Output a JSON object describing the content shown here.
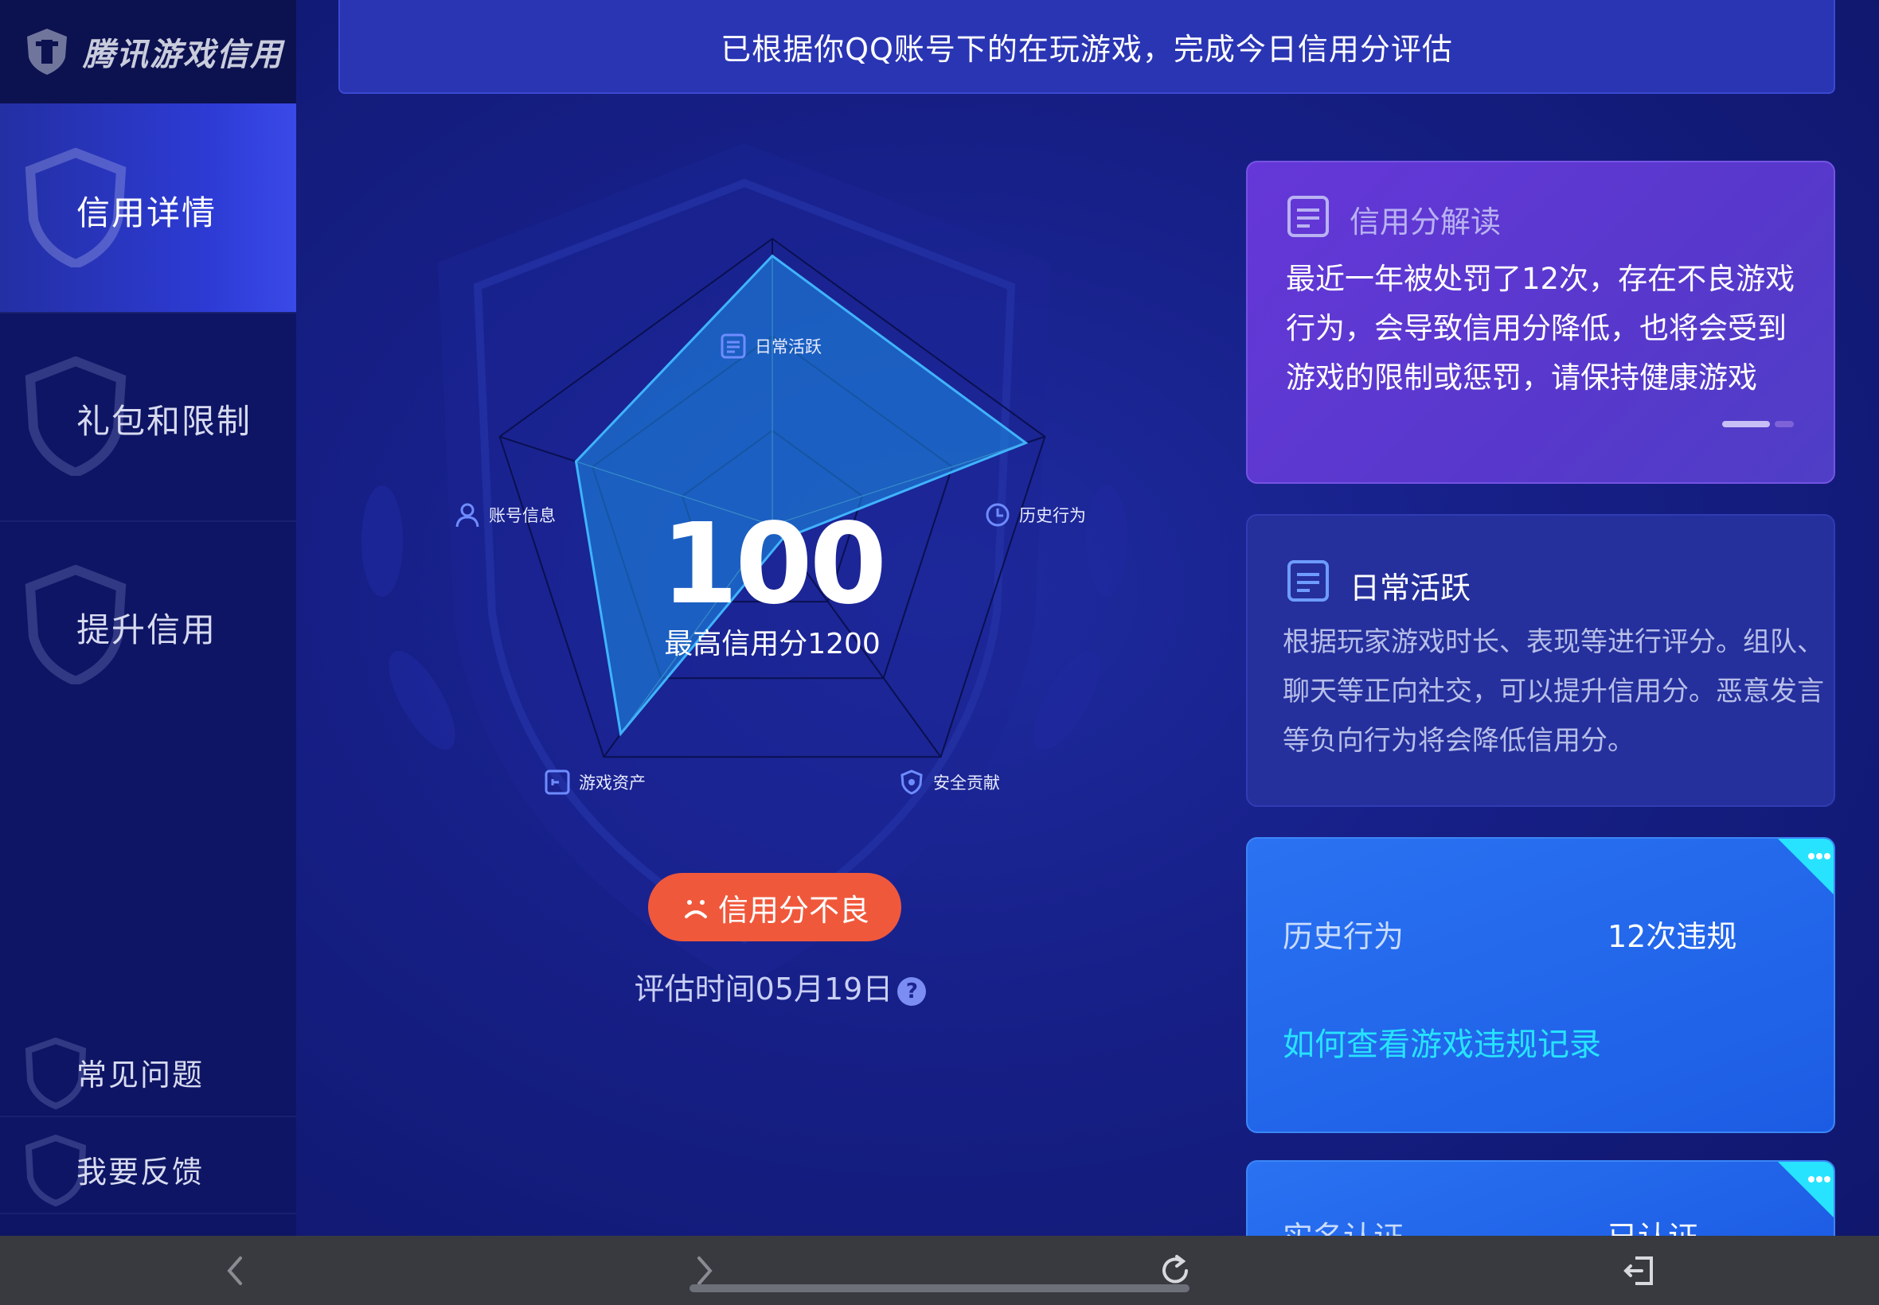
{
  "app": {
    "logo_text": "腾讯游戏信用"
  },
  "sidebar": {
    "items": [
      {
        "label": "信用详情",
        "active": true
      },
      {
        "label": "礼包和限制",
        "active": false
      },
      {
        "label": "提升信用",
        "active": false
      }
    ],
    "bottom_items": [
      {
        "label": "常见问题"
      },
      {
        "label": "我要反馈"
      }
    ]
  },
  "banner": {
    "text": "已根据你QQ账号下的在玩游戏，完成今日信用分评估"
  },
  "radar": {
    "axes": {
      "daily": "日常活跃",
      "history": "历史行为",
      "security": "安全贡献",
      "assets": "游戏资产",
      "account": "账号信息"
    },
    "score": "100",
    "max_label": "最高信用分1200",
    "status_label": "信用分不良",
    "eval_time": "评估时间05月19日",
    "help_icon": "?"
  },
  "chart_data": {
    "type": "radar",
    "categories": [
      "日常活跃",
      "历史行为",
      "安全贡献",
      "游戏资产",
      "账号信息"
    ],
    "values": [
      0.94,
      0.93,
      0.06,
      0.9,
      0.72
    ],
    "range": [
      0,
      1
    ],
    "grid": true
  },
  "cards": {
    "interpret": {
      "title": "信用分解读",
      "body": "最近一年被处罚了12次，存在不良游戏行为，会导致信用分降低，也将会受到游戏的限制或惩罚，请保持健康游戏"
    },
    "daily": {
      "title": "日常活跃",
      "body": "根据玩家游戏时长、表现等进行评分。组队、聊天等正向社交，可以提升信用分。恶意发言等负向行为将会降低信用分。"
    },
    "history": {
      "label": "历史行为",
      "value": "12次违规",
      "link": "如何查看游戏违规记录"
    },
    "realname": {
      "label": "实名认证",
      "value": "已认证"
    }
  },
  "colors": {
    "background": "#161f86",
    "sidebar": "#0e1564",
    "active_item": "#2d3bd4",
    "radar_fill": "#1e8fe8",
    "status_red": "#f0583b",
    "interpret_card": "#6537d8",
    "history_card": "#2a72f2",
    "link": "#27e3ff"
  },
  "browser_bar": {
    "icons": [
      "back-icon",
      "forward-icon",
      "reload-icon",
      "exit-icon"
    ]
  }
}
